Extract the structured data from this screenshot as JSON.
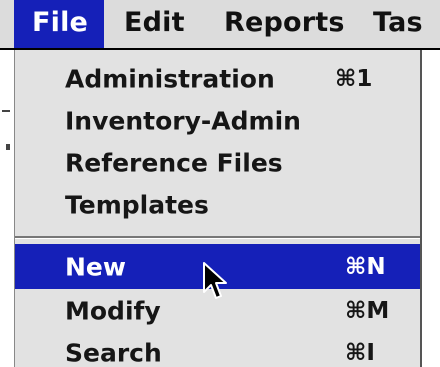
{
  "menubar": {
    "items": [
      {
        "label": "File",
        "active": true
      },
      {
        "label": "Edit",
        "active": false
      },
      {
        "label": "Reports",
        "active": false
      },
      {
        "label": "Tas",
        "active": false
      }
    ]
  },
  "file_menu": {
    "items": [
      {
        "label": "Administration",
        "shortcut": "⌘1",
        "highlighted": false
      },
      {
        "label": "Inventory-Admin",
        "shortcut": "",
        "highlighted": false
      },
      {
        "label": "Reference Files",
        "shortcut": "",
        "highlighted": false
      },
      {
        "label": "Templates",
        "shortcut": "",
        "highlighted": false
      },
      {
        "label": "New",
        "shortcut": "⌘N",
        "highlighted": true
      },
      {
        "label": "Modify",
        "shortcut": "⌘M",
        "highlighted": false
      },
      {
        "label": "Search",
        "shortcut": "⌘I",
        "highlighted": false
      }
    ]
  },
  "colors": {
    "highlight": "#1520b8",
    "menu_background": "#e2e2e2",
    "menubar_background": "#dcdcdc"
  },
  "icons": {
    "cursor": "arrow-cursor-icon"
  }
}
